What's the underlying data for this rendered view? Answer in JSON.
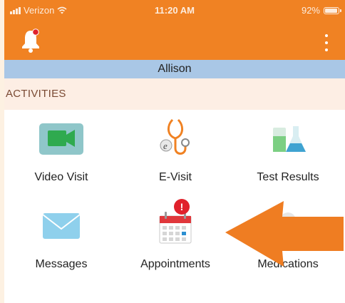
{
  "status_bar": {
    "carrier": "Verizon",
    "time": "11:20 AM",
    "battery_percent": "92%",
    "battery_level": 0.92
  },
  "nav_bar": {
    "notification_icon": "bell-icon",
    "menu_icon": "more-vertical-icon"
  },
  "user_bar": {
    "name": "Allison"
  },
  "activities": {
    "header": "ACTIVITIES",
    "items": [
      {
        "label": "Video Visit",
        "icon": "video-camera-icon"
      },
      {
        "label": "E-Visit",
        "icon": "stethoscope-icon"
      },
      {
        "label": "Test Results",
        "icon": "lab-flasks-icon"
      },
      {
        "label": "Messages",
        "icon": "envelope-icon"
      },
      {
        "label": "Appointments",
        "icon": "calendar-icon",
        "badge": "!"
      },
      {
        "label": "Medications",
        "icon": "pill-icon"
      }
    ]
  },
  "overlay": {
    "icon": "arrow-left-icon"
  },
  "colors": {
    "brand_orange": "#f08223",
    "user_bar_blue": "#a9c7e6",
    "section_bg": "#fdeee4",
    "badge_red": "#e0212b",
    "arrow_orange": "#ef7d22"
  }
}
